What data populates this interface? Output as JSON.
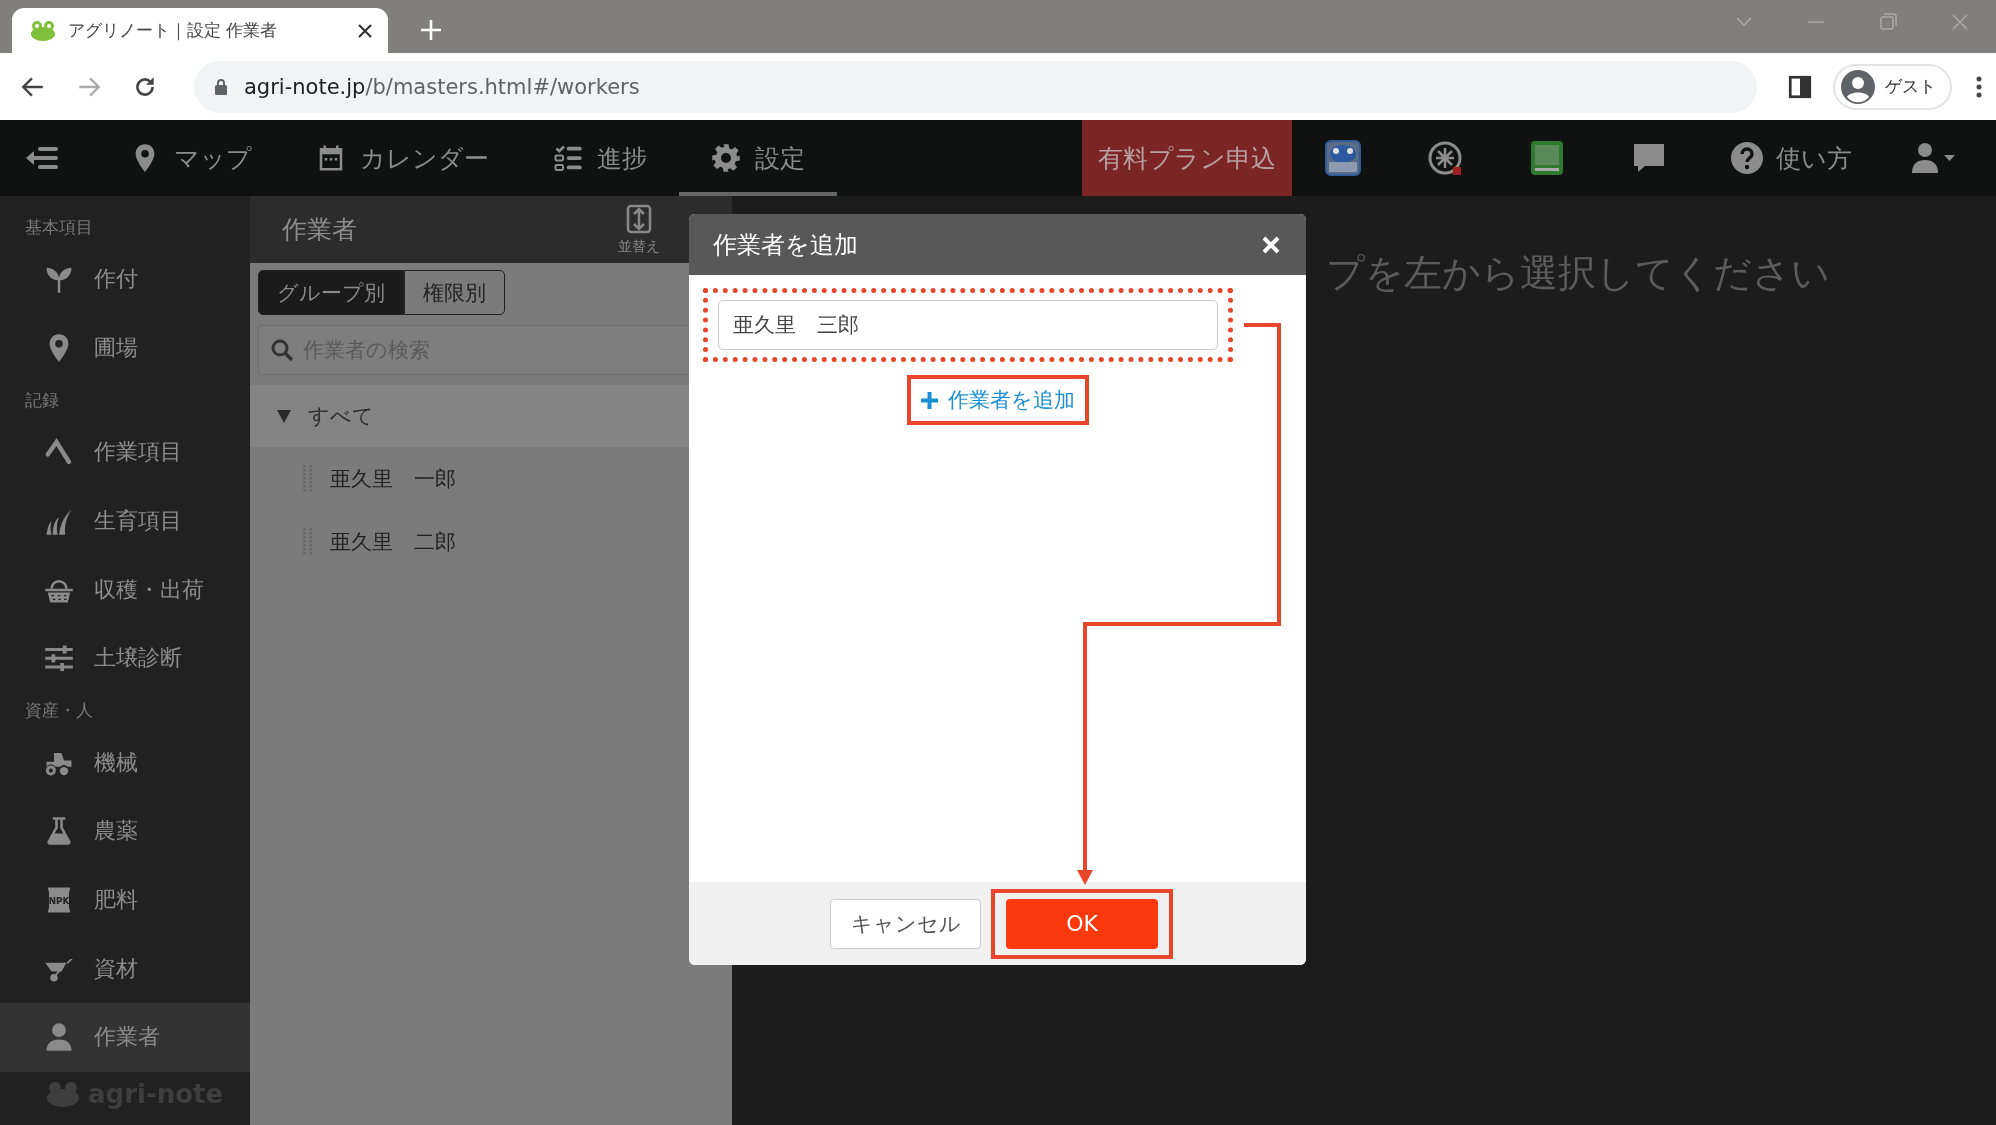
{
  "browser": {
    "tab_title": "アグリノート｜設定 作業者",
    "url_host": "agri-note.jp",
    "url_path": "/b/masters.html#/workers",
    "profile": "ゲスト"
  },
  "nav": {
    "items": [
      {
        "kind": "pin",
        "label": "マップ",
        "selected": false
      },
      {
        "kind": "calendar",
        "label": "カレンダー",
        "selected": false
      },
      {
        "kind": "checklist",
        "label": "進捗",
        "selected": false
      },
      {
        "kind": "gear",
        "label": "設定",
        "selected": true
      }
    ],
    "plan_button": "有料プラン申込",
    "help": "使い方"
  },
  "sidebar": {
    "sections": [
      {
        "title": "基本項目",
        "items": [
          {
            "kind": "sprout",
            "label": "作付",
            "selected": false
          },
          {
            "kind": "pin",
            "label": "圃場",
            "selected": false
          }
        ]
      },
      {
        "title": "記録",
        "items": [
          {
            "kind": "hoe",
            "label": "作業項目",
            "selected": false
          },
          {
            "kind": "grass",
            "label": "生育項目",
            "selected": false
          },
          {
            "kind": "basket",
            "label": "収穫・出荷",
            "selected": false
          },
          {
            "kind": "sliders",
            "label": "土壌診断",
            "selected": false
          }
        ]
      },
      {
        "title": "資産・人",
        "items": [
          {
            "kind": "tractor",
            "label": "機械",
            "selected": false
          },
          {
            "kind": "flask",
            "label": "農薬",
            "selected": false
          },
          {
            "kind": "bag",
            "label": "肥料",
            "selected": false,
            "icon_text": "NPK"
          },
          {
            "kind": "wheelbarrow",
            "label": "資材",
            "selected": false
          },
          {
            "kind": "person",
            "label": "作業者",
            "selected": true
          }
        ]
      }
    ],
    "logo": "agri-note"
  },
  "panel": {
    "title": "作業者",
    "sort_label": "並替え",
    "tabs": [
      {
        "label": "グループ別",
        "selected": true
      },
      {
        "label": "権限別",
        "selected": false
      }
    ],
    "search": {
      "placeholder": "作業者の検索"
    },
    "group": {
      "label": "すべて",
      "expanded": true,
      "children": [
        {
          "label": "亜久里　一郎"
        },
        {
          "label": "亜久里　二郎"
        }
      ]
    }
  },
  "message": "プを左から選択してください",
  "dialog": {
    "title": "作業者を追加",
    "input": {
      "value": "亜久里　三郎"
    },
    "add_link": "作業者を追加",
    "cancel": "キャンセル",
    "ok": "OK"
  }
}
